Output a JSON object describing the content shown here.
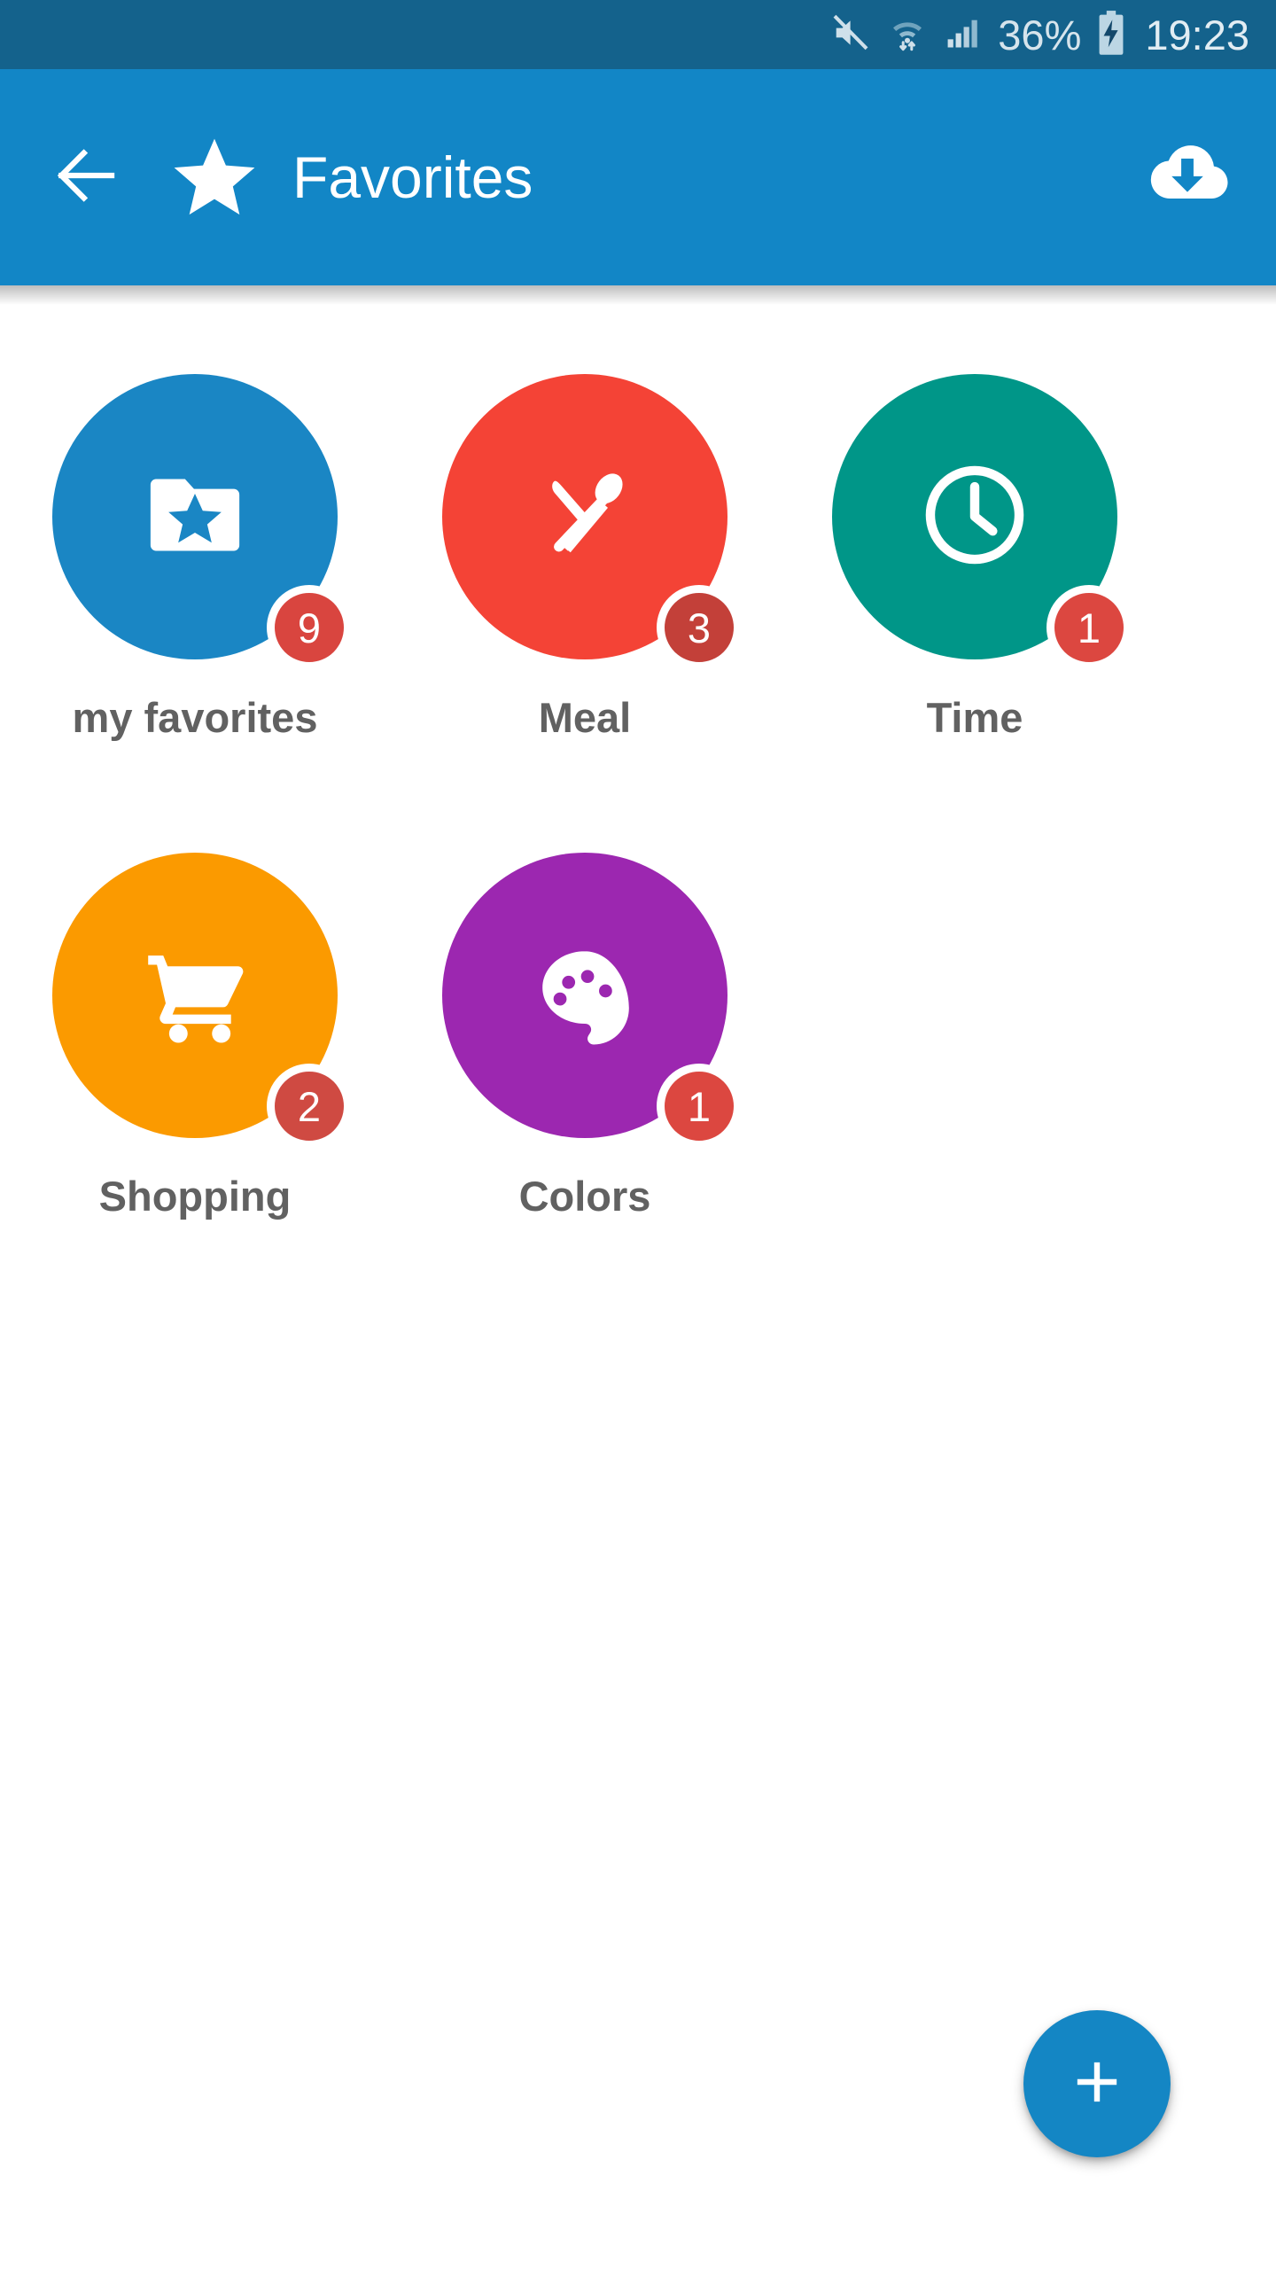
{
  "status_bar": {
    "background": "#14628c",
    "mute_icon": "mute-icon",
    "wifi_icon": "wifi-transfer-icon",
    "signal_icon": "cellular-signal-icon",
    "battery_percent": "36%",
    "battery_icon": "battery-charging-icon",
    "time": "19:23"
  },
  "app_bar": {
    "background": "#1286c6",
    "back_icon": "back-arrow-icon",
    "star_icon": "star-icon",
    "title": "Favorites",
    "download_icon": "cloud-download-icon"
  },
  "tiles": [
    {
      "label": "my favorites",
      "badge": "9",
      "color": "#1a86c4",
      "badge_color": "#d9453f",
      "icon": "folder-star-icon"
    },
    {
      "label": "Meal",
      "badge": "3",
      "color": "#f44336",
      "badge_color": "#c34039",
      "icon": "knife-spoon-icon"
    },
    {
      "label": "Time",
      "badge": "1",
      "color": "#009688",
      "badge_color": "#dc4740",
      "icon": "clock-icon"
    },
    {
      "label": "Shopping",
      "badge": "2",
      "color": "#fb9a00",
      "badge_color": "#cf4a42",
      "icon": "shopping-cart-icon"
    },
    {
      "label": "Colors",
      "badge": "1",
      "color": "#9c27b0",
      "badge_color": "#dc4740",
      "icon": "palette-icon"
    }
  ],
  "fab": {
    "icon": "plus-icon",
    "color": "#1486c4",
    "label": "+"
  },
  "colors": {
    "status_bar": "#14628c",
    "app_bar": "#1286c6",
    "accent": "#1486c4",
    "background": "#ffffff",
    "label_text": "#616161"
  }
}
